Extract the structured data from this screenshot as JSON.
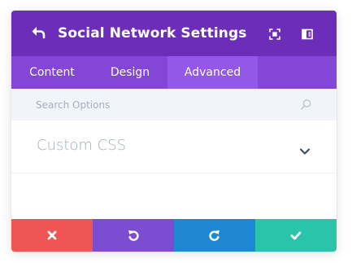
{
  "header": {
    "title": "Social Network Settings",
    "icons": [
      "back-arrow-icon",
      "fullscreen-icon",
      "sidebar-toggle-icon"
    ]
  },
  "tabs": [
    {
      "label": "Content",
      "active": false
    },
    {
      "label": "Design",
      "active": false
    },
    {
      "label": "Advanced",
      "active": true
    }
  ],
  "search": {
    "placeholder": "Search Options",
    "value": ""
  },
  "sections": [
    {
      "title": "Custom CSS",
      "expanded": false
    }
  ],
  "footer": {
    "buttons": [
      {
        "action": "cancel",
        "icon": "close-icon",
        "color": "#ef5555"
      },
      {
        "action": "undo",
        "icon": "undo-icon",
        "color": "#7c4dd1"
      },
      {
        "action": "redo",
        "icon": "redo-icon",
        "color": "#1e88d5"
      },
      {
        "action": "save",
        "icon": "check-icon",
        "color": "#29c4a9"
      }
    ]
  },
  "colors": {
    "header": "#6c2eb9",
    "tabs": "#8346d6",
    "active_tab": "#9458e8",
    "search_bg": "#f1f4f9"
  }
}
